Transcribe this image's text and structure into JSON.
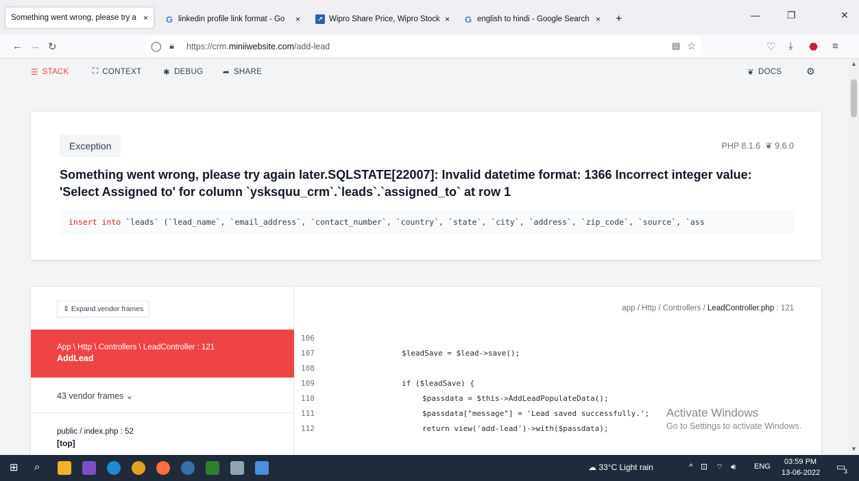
{
  "browser": {
    "tabs": [
      {
        "title": "Something went wrong, please try a",
        "icon": "page-icon",
        "active": true
      },
      {
        "title": "linkedin profile link format - Go",
        "icon": "google-g-icon"
      },
      {
        "title": "Wipro Share Price, Wipro Stock",
        "icon": "chart-favicon-icon"
      },
      {
        "title": "english to hindi - Google Search",
        "icon": "google-g-icon"
      }
    ],
    "new_tab": "+",
    "close_glyph": "×",
    "url_prefix": "https://crm.",
    "url_domain": "miniiwebsite.com",
    "url_path": "/add-lead"
  },
  "topnav": {
    "stack": "STACK",
    "context": "CONTEXT",
    "debug": "DEBUG",
    "share": "SHARE",
    "docs": "DOCS"
  },
  "exception": {
    "badge": "Exception",
    "php_version": "PHP 8.1.6",
    "laravel_version": "9.6.0",
    "message_line1": "Something went wrong, please try again later.SQLSTATE[22007]: Invalid datetime format: 1366 Incorrect integer value:",
    "message_line2": "'Select Assigned to' for column `ysksquu_crm`.`leads`.`assigned_to` at row 1",
    "sql_keyword": "insert into",
    "sql_rest": " `leads` (`lead_name`, `email_address`, `contact_number`, `country`, `state`, `city`, `address`, `zip_code`, `source`, `ass"
  },
  "stack": {
    "expand_label": "Expand vendor frames",
    "active_frame_class": "App \\ Http \\ Controllers \\ LeadController : 121",
    "active_frame_fn": "AddLead",
    "vendor_frames": "43 vendor frames",
    "index_frame": "public / ",
    "index_file": "index.php",
    "index_line": " : 52",
    "index_top": "[top]",
    "file_path_prefix": "app / Http / Controllers / ",
    "file_name": "LeadController.php",
    "file_line": " : 121"
  },
  "code_lines": [
    {
      "no": "106",
      "text": ""
    },
    {
      "no": "107",
      "text": "$leadSave = $lead->save();"
    },
    {
      "no": "108",
      "text": ""
    },
    {
      "no": "109",
      "text": "if ($leadSave) {"
    },
    {
      "no": "110",
      "text": "$passdata = $this->AddLeadPopulateData();"
    },
    {
      "no": "111",
      "text": "$passdata[\"message\"] = 'Lead saved successfully.';"
    },
    {
      "no": "112",
      "text": "return view('add-lead')->with($passdata);"
    }
  ],
  "watermark": {
    "line1": "Activate Windows",
    "line2": "Go to Settings to activate Windows."
  },
  "taskbar": {
    "weather": "33°C  Light rain",
    "lang": "ENG",
    "time": "03:59 PM",
    "date": "13-06-2022",
    "notif_count": "3"
  }
}
